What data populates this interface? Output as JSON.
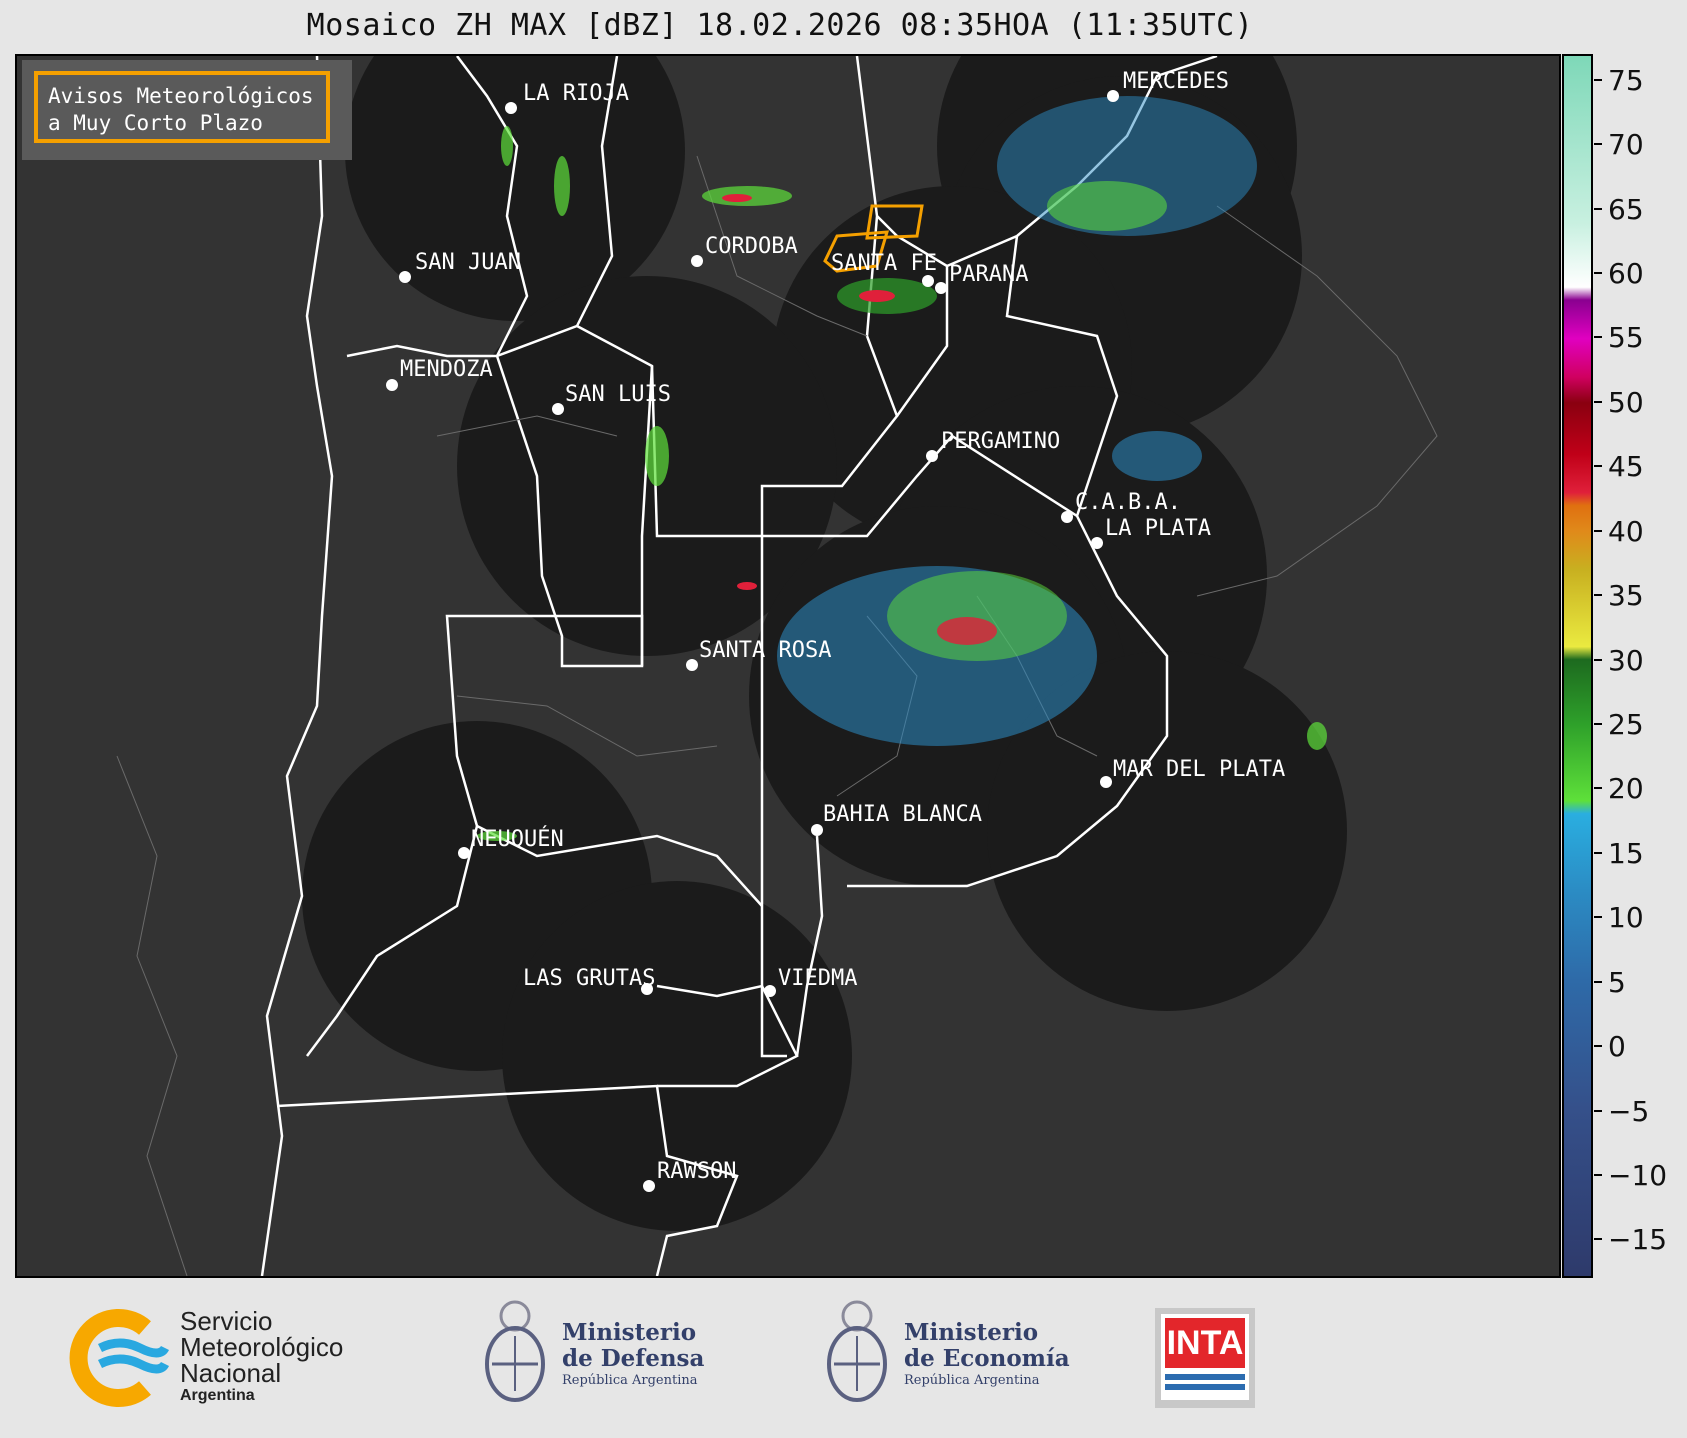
{
  "title": "Mosaico ZH MAX [dBZ] 18.02.2026 08:35HOA (11:35UTC)",
  "legend": {
    "line1": "Avisos Meteorológicos",
    "line2": "a Muy Corto Plazo",
    "border_color": "#f5a000"
  },
  "cities": [
    {
      "name": "LA RIOJA"
    },
    {
      "name": "SAN JUAN"
    },
    {
      "name": "CORDOBA"
    },
    {
      "name": "SANTA FE"
    },
    {
      "name": "PARANA"
    },
    {
      "name": "MERCEDES"
    },
    {
      "name": "MENDOZA"
    },
    {
      "name": "SAN LUIS"
    },
    {
      "name": "PERGAMINO"
    },
    {
      "name": "C.A.B.A."
    },
    {
      "name": "LA PLATA"
    },
    {
      "name": "SANTA ROSA"
    },
    {
      "name": "MAR DEL PLATA"
    },
    {
      "name": "BAHIA BLANCA"
    },
    {
      "name": "NEUQUÉN"
    },
    {
      "name": "LAS GRUTAS"
    },
    {
      "name": "VIEDMA"
    },
    {
      "name": "RAWSON"
    }
  ],
  "colorbar": {
    "min": -18,
    "max": 77,
    "ticks": [
      "75",
      "70",
      "65",
      "60",
      "55",
      "50",
      "45",
      "40",
      "35",
      "30",
      "25",
      "20",
      "15",
      "10",
      "5",
      "0",
      "−5",
      "−10",
      "−15"
    ],
    "tick_values": [
      75,
      70,
      65,
      60,
      55,
      50,
      45,
      40,
      35,
      30,
      25,
      20,
      15,
      10,
      5,
      0,
      -5,
      -10,
      -15
    ],
    "stops": [
      {
        "v": -18,
        "c": "#2e3a6b"
      },
      {
        "v": -5,
        "c": "#35508a"
      },
      {
        "v": 5,
        "c": "#2e6aa8"
      },
      {
        "v": 12,
        "c": "#2b8cc4"
      },
      {
        "v": 18,
        "c": "#2aaee0"
      },
      {
        "v": 19,
        "c": "#5ee03a"
      },
      {
        "v": 25,
        "c": "#2ea02a"
      },
      {
        "v": 30,
        "c": "#1d6a1f"
      },
      {
        "v": 31,
        "c": "#eaea40"
      },
      {
        "v": 37,
        "c": "#c8b020"
      },
      {
        "v": 40,
        "c": "#e08a1a"
      },
      {
        "v": 42,
        "c": "#e07010"
      },
      {
        "v": 43,
        "c": "#e0203a"
      },
      {
        "v": 46,
        "c": "#c00018"
      },
      {
        "v": 50,
        "c": "#8a0010"
      },
      {
        "v": 52,
        "c": "#d00060"
      },
      {
        "v": 55,
        "c": "#e000c0"
      },
      {
        "v": 58,
        "c": "#8a0090"
      },
      {
        "v": 59,
        "c": "#ffffff"
      },
      {
        "v": 64,
        "c": "#c8f0e0"
      },
      {
        "v": 77,
        "c": "#7ed8b8"
      }
    ]
  },
  "logos": {
    "smn": {
      "line1": "Servicio",
      "line2": "Meteorológico",
      "line3": "Nacional",
      "line4": "Argentina",
      "color_ring": "#f7a800",
      "color_wave": "#29a8e0"
    },
    "defensa": {
      "line1": "Ministerio",
      "line2": "de Defensa",
      "line3": "República Argentina"
    },
    "economia": {
      "line1": "Ministerio",
      "line2": "de Economía",
      "line3": "República Argentina"
    },
    "inta": {
      "text": "INTA",
      "color": "#e3262b"
    }
  },
  "colors": {
    "map_background": "#333333",
    "radar_coverage": "#1b1b1b",
    "borders": "#ffffff",
    "alert_polygon": "#f5a000"
  }
}
